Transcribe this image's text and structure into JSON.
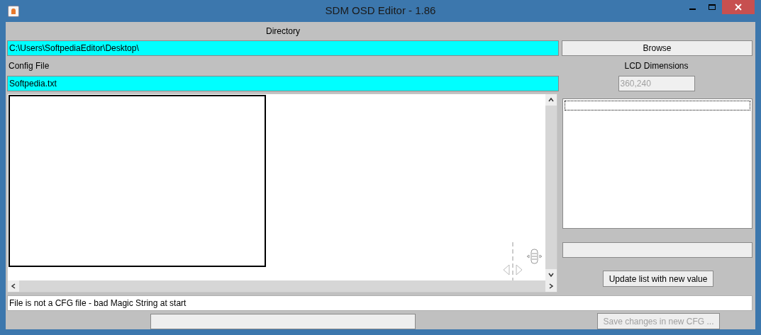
{
  "window": {
    "title": "SDM OSD Editor - 1.86"
  },
  "directory": {
    "label": "Directory",
    "value": "C:\\Users\\SoftpediaEditor\\Desktop\\"
  },
  "browse_button": {
    "label": "Browse"
  },
  "config_file": {
    "label": "Config File",
    "value": "Softpedia.txt"
  },
  "lcd_dimensions": {
    "label": "LCD Dimensions",
    "value": "360,240",
    "disabled": true
  },
  "update_button": {
    "label": "Update list with new value",
    "disabled": false
  },
  "status": {
    "value": "File is not a CFG file - bad Magic String at start"
  },
  "save_button": {
    "label": "Save changes in new CFG ...",
    "disabled": true
  }
}
